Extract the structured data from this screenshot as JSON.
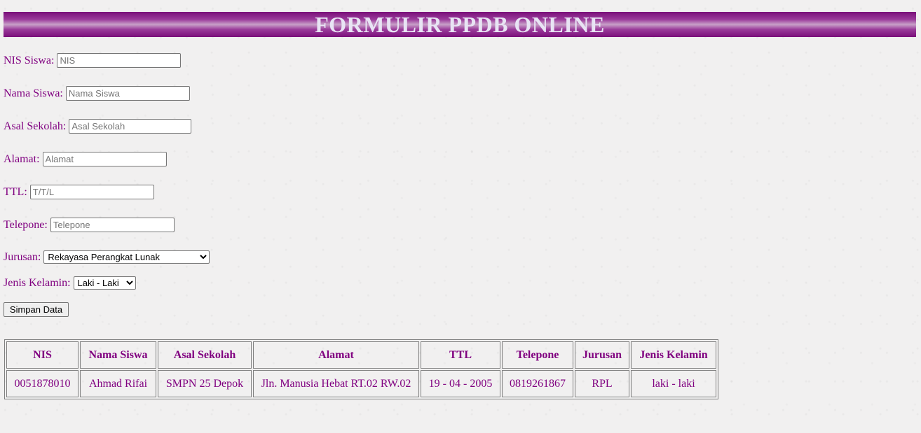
{
  "header": {
    "title": "FORMULIR PPDB ONLINE"
  },
  "form": {
    "nis": {
      "label": "NIS Siswa:",
      "placeholder": "NIS"
    },
    "nama": {
      "label": "Nama Siswa:",
      "placeholder": "Nama Siswa"
    },
    "asal": {
      "label": "Asal Sekolah:",
      "placeholder": "Asal Sekolah"
    },
    "alamat": {
      "label": "Alamat:",
      "placeholder": "Alamat"
    },
    "ttl": {
      "label": "TTL:",
      "placeholder": "T/T/L"
    },
    "telepone": {
      "label": "Telepone:",
      "placeholder": "Telepone"
    },
    "jurusan": {
      "label": "Jurusan:",
      "selected": "Rekayasa Perangkat Lunak"
    },
    "jenis_kelamin": {
      "label": "Jenis Kelamin:",
      "selected": "Laki - Laki"
    },
    "submit_label": "Simpan Data"
  },
  "table": {
    "headers": [
      "NIS",
      "Nama Siswa",
      "Asal Sekolah",
      "Alamat",
      "TTL",
      "Telepone",
      "Jurusan",
      "Jenis Kelamin"
    ],
    "rows": [
      [
        "0051878010",
        "Ahmad Rifai",
        "SMPN 25 Depok",
        "Jln. Manusia Hebat RT.02 RW.02",
        "19 - 04 - 2005",
        "0819261867",
        "RPL",
        "laki - laki"
      ]
    ]
  },
  "colors": {
    "text": "#800080",
    "banner": "#7a0f7a",
    "banner_text": "#e8e4f4",
    "background": "#f1f0f0"
  }
}
